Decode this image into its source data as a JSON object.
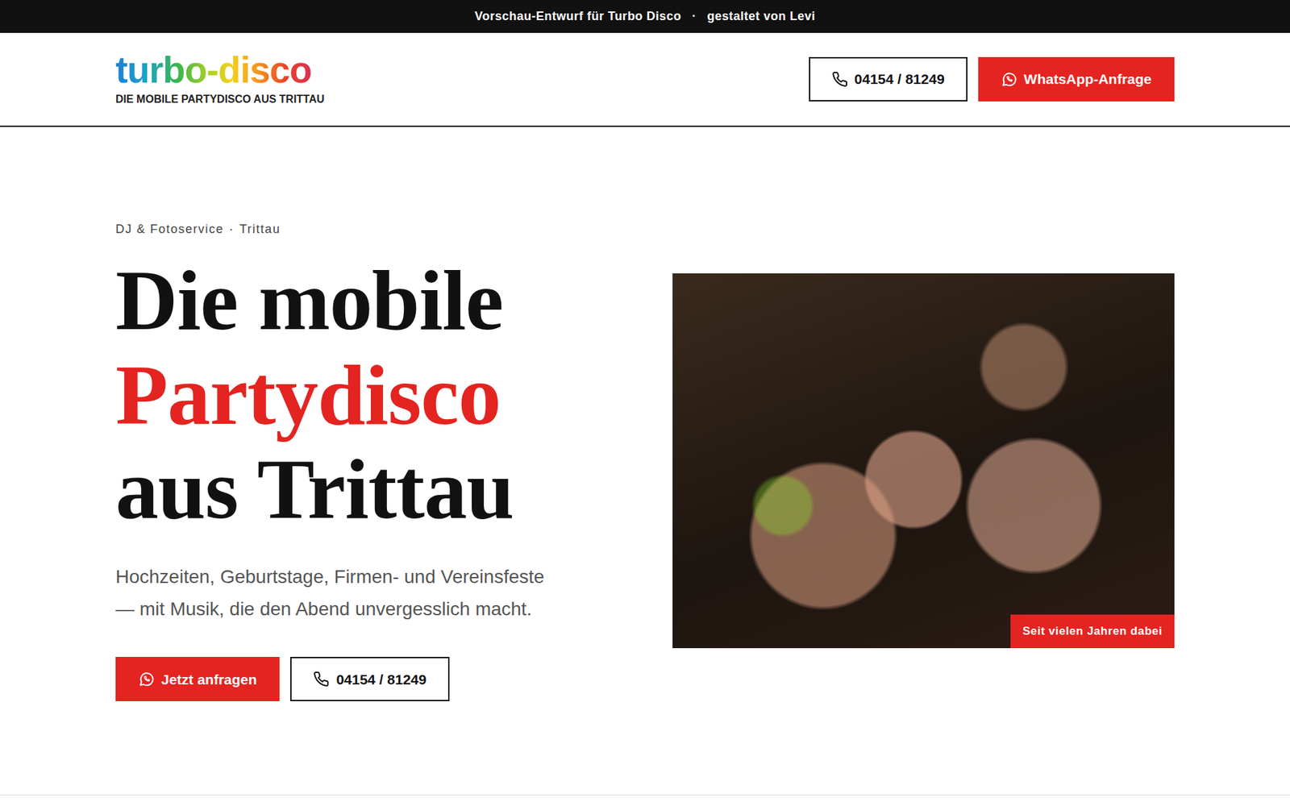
{
  "preview_bar": {
    "text": "Vorschau-Entwurf für Turbo Disco",
    "separator": "·",
    "credit": "gestaltet von Levi"
  },
  "header": {
    "logo": "turbo-disco",
    "tagline": "DIE MOBILE PARTYDISCO AUS TRITTAU",
    "buttons": [
      {
        "label": "04154 / 81249",
        "kind": "phone"
      },
      {
        "label": "WhatsApp-Anfrage",
        "kind": "whatsapp"
      }
    ]
  },
  "hero": {
    "eyebrow": [
      "DJ & Fotoservice",
      "Trittau"
    ],
    "eyebrow_separator": "·",
    "title_lines": [
      {
        "text": "Die mobile",
        "highlight": false
      },
      {
        "text": "Partydisco",
        "highlight": true
      },
      {
        "text": "aus Trittau",
        "highlight": false
      }
    ],
    "lead": "Hochzeiten, Geburtstage, Firmen- und Vereinsfeste — mit Musik, die den Abend unvergesslich macht.",
    "buttons": [
      {
        "label": "Jetzt anfragen",
        "kind": "whatsapp"
      },
      {
        "label": "04154 / 81249",
        "kind": "phone"
      }
    ],
    "photo": {
      "badge": "Seit vielen Jahren dabei"
    }
  }
}
